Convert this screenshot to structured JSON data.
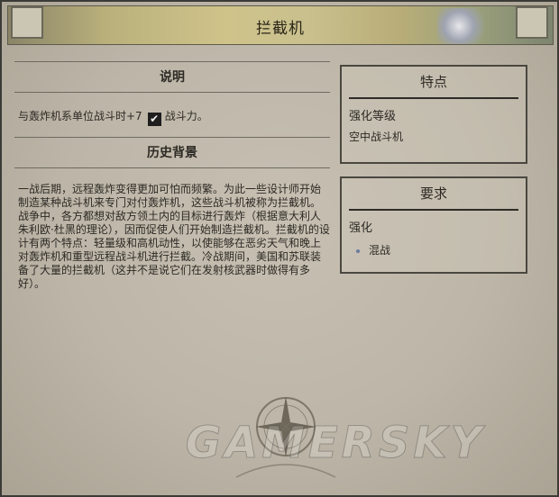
{
  "window": {
    "title": "拦截机"
  },
  "description": {
    "header": "说明",
    "effect_prefix": "与轰炸机系单位战斗时+7",
    "effect_icon": "strength-icon",
    "effect_suffix": "战斗力。"
  },
  "history": {
    "header": "历史背景",
    "text": "一战后期，远程轰炸变得更加可怕而频繁。为此一些设计师开始制造某种战斗机来专门对付轰炸机，这些战斗机被称为拦截机。战争中，各方都想对敌方领土内的目标进行轰炸（根据意大利人朱利欧·杜黑的理论），因而促使人们开始制造拦截机。拦截机的设计有两个特点：轻量级和高机动性，以使能够在恶劣天气和晚上对轰炸机和重型远程战斗机进行拦截。冷战期间，美国和苏联装备了大量的拦截机（这并不是说它们在发射核武器时做得有多好）。"
  },
  "features": {
    "header": "特点",
    "label": "强化等级",
    "value": "空中战斗机"
  },
  "requirements": {
    "header": "要求",
    "label": "强化",
    "items": [
      "混战"
    ]
  },
  "watermark": "GAMERSKY"
}
